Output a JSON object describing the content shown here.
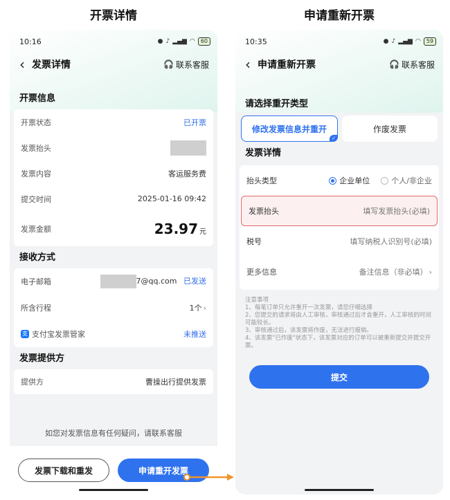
{
  "captions": {
    "left": "开票详情",
    "right": "申请重新开票"
  },
  "left": {
    "status_time": "10:16",
    "battery": "60",
    "title": "发票详情",
    "service": "联系客服",
    "invoice_info": {
      "section": "开票信息",
      "rows": [
        {
          "label": "开票状态",
          "value": "已开票"
        },
        {
          "label": "发票抬头",
          "value": ""
        },
        {
          "label": "发票内容",
          "value": "客运服务费"
        },
        {
          "label": "提交时间",
          "value": "2025-01-16 09:42"
        }
      ],
      "amount_label": "发票金额",
      "amount": "23.97",
      "amount_unit": "元"
    },
    "receive": {
      "section": "接收方式",
      "email_label": "电子邮箱",
      "email_value": "7@qq.com",
      "email_status": "已发送",
      "trip_label": "所含行程",
      "trip_value": "1个",
      "alipay_label": "支付宝发票管家",
      "alipay_status": "未推送"
    },
    "provider": {
      "section": "发票提供方",
      "label": "提供方",
      "value": "曹操出行提供发票"
    },
    "help_text": "如您对发票信息有任何疑问，请联系客服",
    "btn_download": "发票下载和重发",
    "btn_reissue": "申请重开发票"
  },
  "right": {
    "status_time": "10:35",
    "battery": "59",
    "title": "申请重新开票",
    "service": "联系客服",
    "type_section": "请选择重开类型",
    "type_tabs": [
      "修改发票信息并重开",
      "作废发票"
    ],
    "detail_section": "发票详情",
    "header_type_label": "抬头类型",
    "header_type_options": [
      "企业单位",
      "个人/非企业"
    ],
    "title_label": "发票抬头",
    "title_placeholder": "填写发票抬头(必填)",
    "tax_label": "税号",
    "tax_placeholder": "填写纳税人识别号(必填)",
    "more_label": "更多信息",
    "more_placeholder": "备注信息（非必填）",
    "notes": [
      "注意事项",
      "1、每笔订单只允许重开一次发票，请您仔细选择",
      "2、您提交的请求将由人工审核，审核通过后才会重开，人工审核的时间可能较长。",
      "3、审核通过后，该发票将作废，无法进行报销。",
      "4、该发票\"已作废\"状态下，该发票对应的订单可以被重新提交并提交开票。"
    ],
    "submit": "提交"
  }
}
